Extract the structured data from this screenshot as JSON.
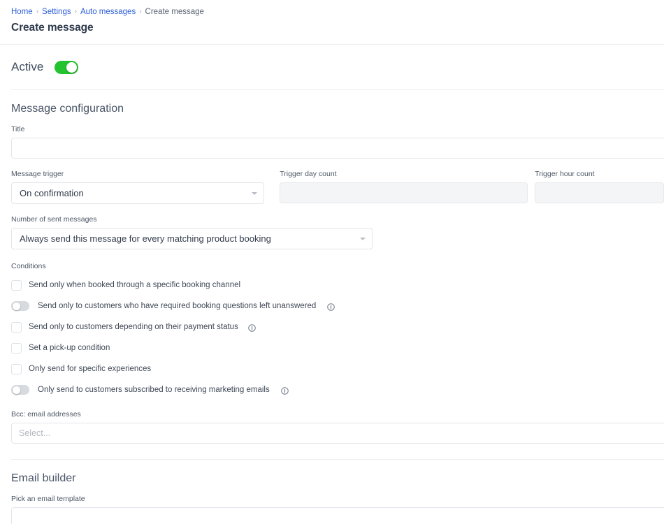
{
  "breadcrumb": {
    "items": [
      {
        "label": "Home",
        "link": true
      },
      {
        "label": "Settings",
        "link": true
      },
      {
        "label": "Auto messages",
        "link": true
      },
      {
        "label": "Create message",
        "link": false
      }
    ],
    "separator": "›"
  },
  "page": {
    "title": "Create message"
  },
  "active": {
    "label": "Active",
    "state": "on"
  },
  "message_configuration": {
    "section_title": "Message configuration",
    "title_field": {
      "label": "Title",
      "value": "",
      "placeholder": ""
    },
    "message_trigger": {
      "label": "Message trigger",
      "value": "On confirmation"
    },
    "trigger_day_count": {
      "label": "Trigger day count",
      "value": "",
      "disabled": true
    },
    "trigger_hour_count": {
      "label": "Trigger hour count",
      "value": "",
      "disabled": true
    },
    "number_of_sent_messages": {
      "label": "Number of sent messages",
      "value": "Always send this message for every matching product booking"
    },
    "conditions": {
      "label": "Conditions",
      "items": [
        {
          "control": "checkbox",
          "checked": false,
          "label": "Send only when booked through a specific booking channel",
          "info": false
        },
        {
          "control": "toggle",
          "checked": false,
          "label": "Send only to customers who have required booking questions left unanswered",
          "info": true
        },
        {
          "control": "checkbox",
          "checked": false,
          "label": "Send only to customers depending on their payment status",
          "info": true
        },
        {
          "control": "checkbox",
          "checked": false,
          "label": "Set a pick-up condition",
          "info": false
        },
        {
          "control": "checkbox",
          "checked": false,
          "label": "Only send for specific experiences",
          "info": false
        },
        {
          "control": "toggle",
          "checked": false,
          "label": "Only send to customers subscribed to receiving marketing emails",
          "info": true
        }
      ]
    },
    "bcc": {
      "label": "Bcc: email addresses",
      "value": "",
      "placeholder": "Select..."
    }
  },
  "email_builder": {
    "section_title": "Email builder",
    "template_field": {
      "label": "Pick an email template",
      "value": "",
      "placeholder": ""
    }
  },
  "colors": {
    "accent_green": "#22c32e",
    "link_blue": "#2c5fd8",
    "text": "#3c4858",
    "border": "#e2e5ea",
    "disabled_bg": "#f4f5f7"
  }
}
